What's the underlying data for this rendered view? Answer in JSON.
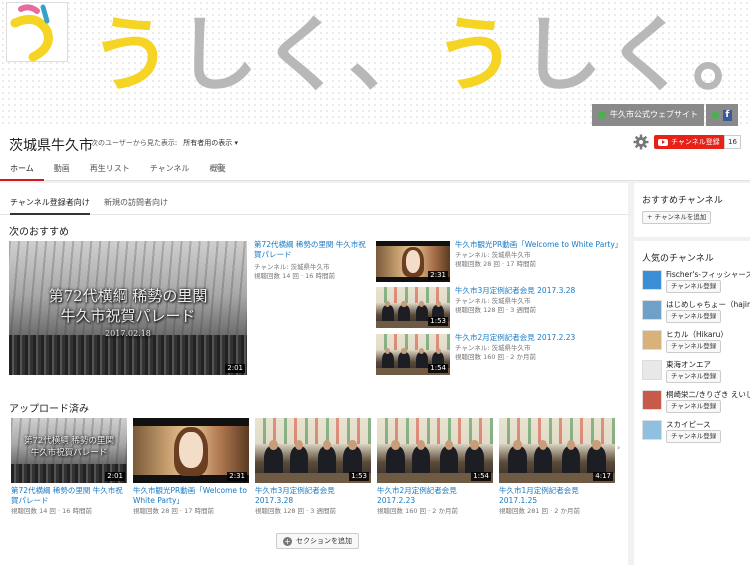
{
  "banner": {
    "chars": [
      {
        "c": "う",
        "color": "#f5d423"
      },
      {
        "c": "し",
        "color": "#b8b8b8"
      },
      {
        "c": "く",
        "color": "#b8b8b8"
      },
      {
        "c": "、",
        "color": "#b8b8b8"
      },
      {
        "c": "う",
        "color": "#f5d423"
      },
      {
        "c": "し",
        "color": "#b8b8b8"
      },
      {
        "c": "く",
        "color": "#b8b8b8"
      },
      {
        "c": "。",
        "color": "#b8b8b8"
      }
    ],
    "link_site": "牛久市公式ウェブサイト"
  },
  "header": {
    "channel_title": "茨城県牛久市",
    "view_as_label": "次のユーザーから見た表示:",
    "view_as_value": "所有者用の表示 ▾",
    "subscribe_label": "チャンネル登録",
    "subscriber_count": "16",
    "tabs": [
      "ホーム",
      "動画",
      "再生リスト",
      "チャンネル",
      "概要"
    ]
  },
  "main": {
    "subtabs": [
      "チャンネル登録者向け",
      "新規の訪問者向け"
    ],
    "featured_section_title": "次のおすすめ",
    "featured": {
      "title": "第72代横綱 稀勢の里関 牛久市祝賀パレード",
      "channel": "チャンネル: 茨城県牛久市",
      "meta": "視聴回数 14 回 · 16 時間前",
      "duration": "2:01",
      "overlay_line1": "第72代横綱 稀勢の里関",
      "overlay_line2": "牛久市祝賀パレード",
      "overlay_date": "2017.02.18"
    },
    "side_videos": [
      {
        "title": "牛久市観光PR動画「Welcome to White Party」",
        "channel": "チャンネル: 茨城県牛久市",
        "meta": "視聴回数 28 回 · 17 時間前",
        "duration": "2:31",
        "kind": "girl"
      },
      {
        "title": "牛久市3月定例記者会見 2017.3.28",
        "channel": "チャンネル: 茨城県牛久市",
        "meta": "視聴回数 128 回 · 3 週間前",
        "duration": "1:53",
        "kind": "press"
      },
      {
        "title": "牛久市2月定例記者会見 2017.2.23",
        "channel": "チャンネル: 茨城県牛久市",
        "meta": "視聴回数 160 回 · 2 か月前",
        "duration": "1:54",
        "kind": "press"
      }
    ],
    "uploads_section_title": "アップロード済み",
    "uploads": [
      {
        "title": "第72代横綱 稀勢の里関 牛久市祝賀パレード",
        "meta": "視聴回数 14 回 · 16 時間前",
        "duration": "2:01",
        "kind": "parade"
      },
      {
        "title": "牛久市観光PR動画「Welcome to White Party」",
        "meta": "視聴回数 28 回 · 17 時間前",
        "duration": "2:31",
        "kind": "girl"
      },
      {
        "title": "牛久市3月定例記者会見 2017.3.28",
        "meta": "視聴回数 128 回 · 3 週間前",
        "duration": "1:53",
        "kind": "press"
      },
      {
        "title": "牛久市2月定例記者会見 2017.2.23",
        "meta": "視聴回数 160 回 · 2 か月前",
        "duration": "1:54",
        "kind": "press"
      },
      {
        "title": "牛久市1月定例記者会見 2017.1.25",
        "meta": "視聴回数 281 回 · 2 か月前",
        "duration": "4:17",
        "kind": "press"
      }
    ],
    "add_section_label": "セクションを追加"
  },
  "sidebar": {
    "recommended_title": "おすすめチャンネル",
    "add_channel_label": "+ チャンネルを追加",
    "popular_title": "人気のチャンネル",
    "subscribe_label": "チャンネル登録",
    "channels": [
      {
        "name": "Fischer's-フィッシャーズ-",
        "color": "#3a8fd6"
      },
      {
        "name": "はじめしゃちょー（hajime）",
        "color": "#6fa0c8"
      },
      {
        "name": "ヒカル（Hikaru）",
        "color": "#d9b27a"
      },
      {
        "name": "東海オンエア",
        "color": "#e8e8e8"
      },
      {
        "name": "桐崎栄二/きりざき えいじ",
        "color": "#c85a4a"
      },
      {
        "name": "スカイピース",
        "color": "#8fc0e0"
      }
    ]
  },
  "colors": {
    "accent": "#cc181e",
    "link": "#167ac6",
    "banner_yellow": "#f5d423"
  }
}
